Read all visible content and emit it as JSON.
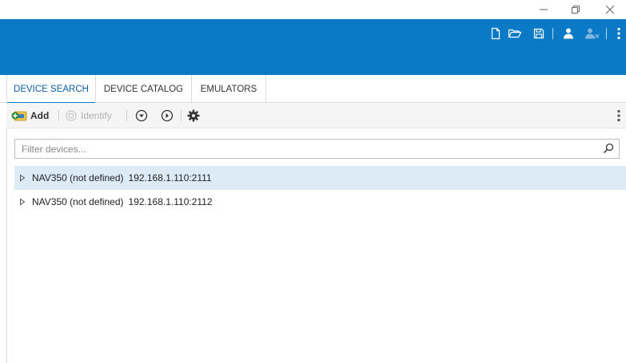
{
  "window": {
    "minimize_glyph": "—",
    "restore_glyph": "❐",
    "close_glyph": "✕"
  },
  "header": {
    "icons": [
      "new-file-icon",
      "open-folder-icon",
      "save-icon",
      "user-icon",
      "user-remove-icon",
      "kebab-menu-icon"
    ]
  },
  "tabs": [
    {
      "label": "DEVICE SEARCH",
      "active": true
    },
    {
      "label": "DEVICE CATALOG",
      "active": false
    },
    {
      "label": "EMULATORS",
      "active": false
    }
  ],
  "toolbar": {
    "add_label": "Add",
    "identify_label": "Identify"
  },
  "filter": {
    "placeholder": "Filter devices...",
    "value": ""
  },
  "devices": [
    {
      "name": "NAV350 (not defined)",
      "address": "192.168.1.110:2111",
      "selected": true
    },
    {
      "name": "NAV350 (not defined)",
      "address": "192.168.1.110:2112",
      "selected": false
    }
  ],
  "colors": {
    "accent": "#0a7ac6",
    "selected_row": "#ddebf7"
  }
}
